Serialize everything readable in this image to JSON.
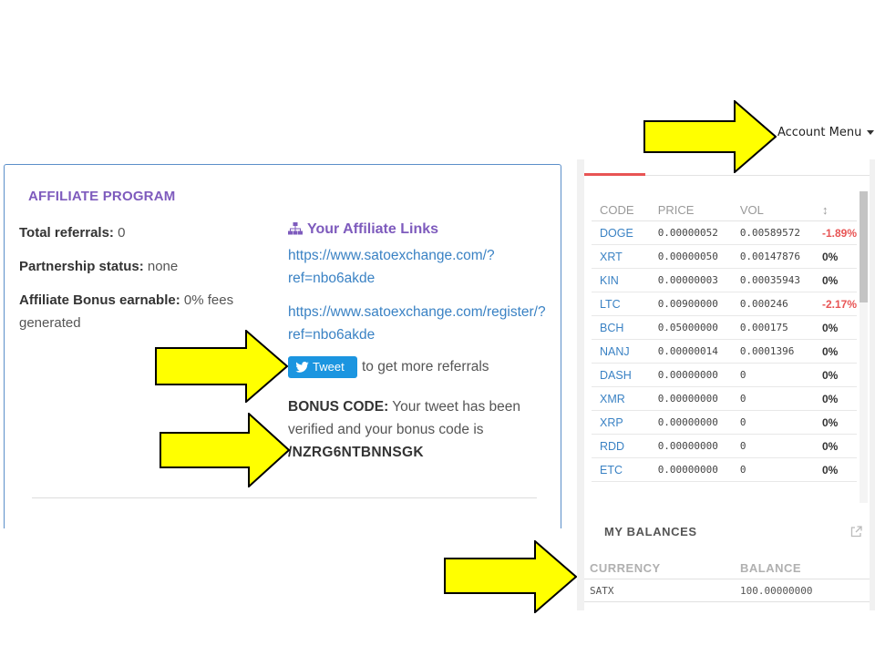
{
  "account_menu": {
    "label": "Account Menu"
  },
  "affiliate": {
    "title": "AFFILIATE PROGRAM",
    "total_referrals_label": "Total referrals:",
    "total_referrals_value": "0",
    "partnership_label": "Partnership status:",
    "partnership_value": "none",
    "bonus_label": "Affiliate Bonus earnable:",
    "bonus_value_line1": "0% fees",
    "bonus_value_line2": "generated",
    "links_heading": "Your Affiliate Links",
    "link1_line1": "https://www.satoexchange.com/?",
    "link1_line2": "ref=nbo6akde",
    "link2_line1": "https://www.satoexchange.com/register/?",
    "link2_line2": "ref=nbo6akde",
    "tweet_button": "Tweet",
    "tweet_text": "to get more referrals",
    "bonus_code_label": "BONUS CODE:",
    "bonus_code_text_1": "Your tweet has been",
    "bonus_code_text_2": "verified and your bonus code is",
    "bonus_code_value": "/NZRG6NTBNNSGK"
  },
  "market": {
    "headers": {
      "code": "CODE",
      "price": "PRICE",
      "vol": "VOL",
      "change": "↕"
    },
    "rows": [
      {
        "code": "DOGE",
        "price": "0.00000052",
        "vol": "0.00589572",
        "change": "-1.89%",
        "negative": true
      },
      {
        "code": "XRT",
        "price": "0.00000050",
        "vol": "0.00147876",
        "change": "0%",
        "negative": false
      },
      {
        "code": "KIN",
        "price": "0.00000003",
        "vol": "0.00035943",
        "change": "0%",
        "negative": false
      },
      {
        "code": "LTC",
        "price": "0.00900000",
        "vol": "0.000246",
        "change": "-2.17%",
        "negative": true
      },
      {
        "code": "BCH",
        "price": "0.05000000",
        "vol": "0.000175",
        "change": "0%",
        "negative": false
      },
      {
        "code": "NANJ",
        "price": "0.00000014",
        "vol": "0.0001396",
        "change": "0%",
        "negative": false
      },
      {
        "code": "DASH",
        "price": "0.00000000",
        "vol": "0",
        "change": "0%",
        "negative": false
      },
      {
        "code": "XMR",
        "price": "0.00000000",
        "vol": "0",
        "change": "0%",
        "negative": false
      },
      {
        "code": "XRP",
        "price": "0.00000000",
        "vol": "0",
        "change": "0%",
        "negative": false
      },
      {
        "code": "RDD",
        "price": "0.00000000",
        "vol": "0",
        "change": "0%",
        "negative": false
      },
      {
        "code": "ETC",
        "price": "0.00000000",
        "vol": "0",
        "change": "0%",
        "negative": false
      }
    ]
  },
  "balances": {
    "title": "MY BALANCES",
    "headers": {
      "currency": "CURRENCY",
      "balance": "BALANCE"
    },
    "rows": [
      {
        "currency": "SATX",
        "balance": "100.00000000"
      }
    ]
  },
  "colors": {
    "accent_purple": "#7e5bbd",
    "link_blue": "#3a82c4",
    "negative_red": "#e85454",
    "arrow_yellow": "#ffff00",
    "tweet_blue": "#1b95e0"
  }
}
